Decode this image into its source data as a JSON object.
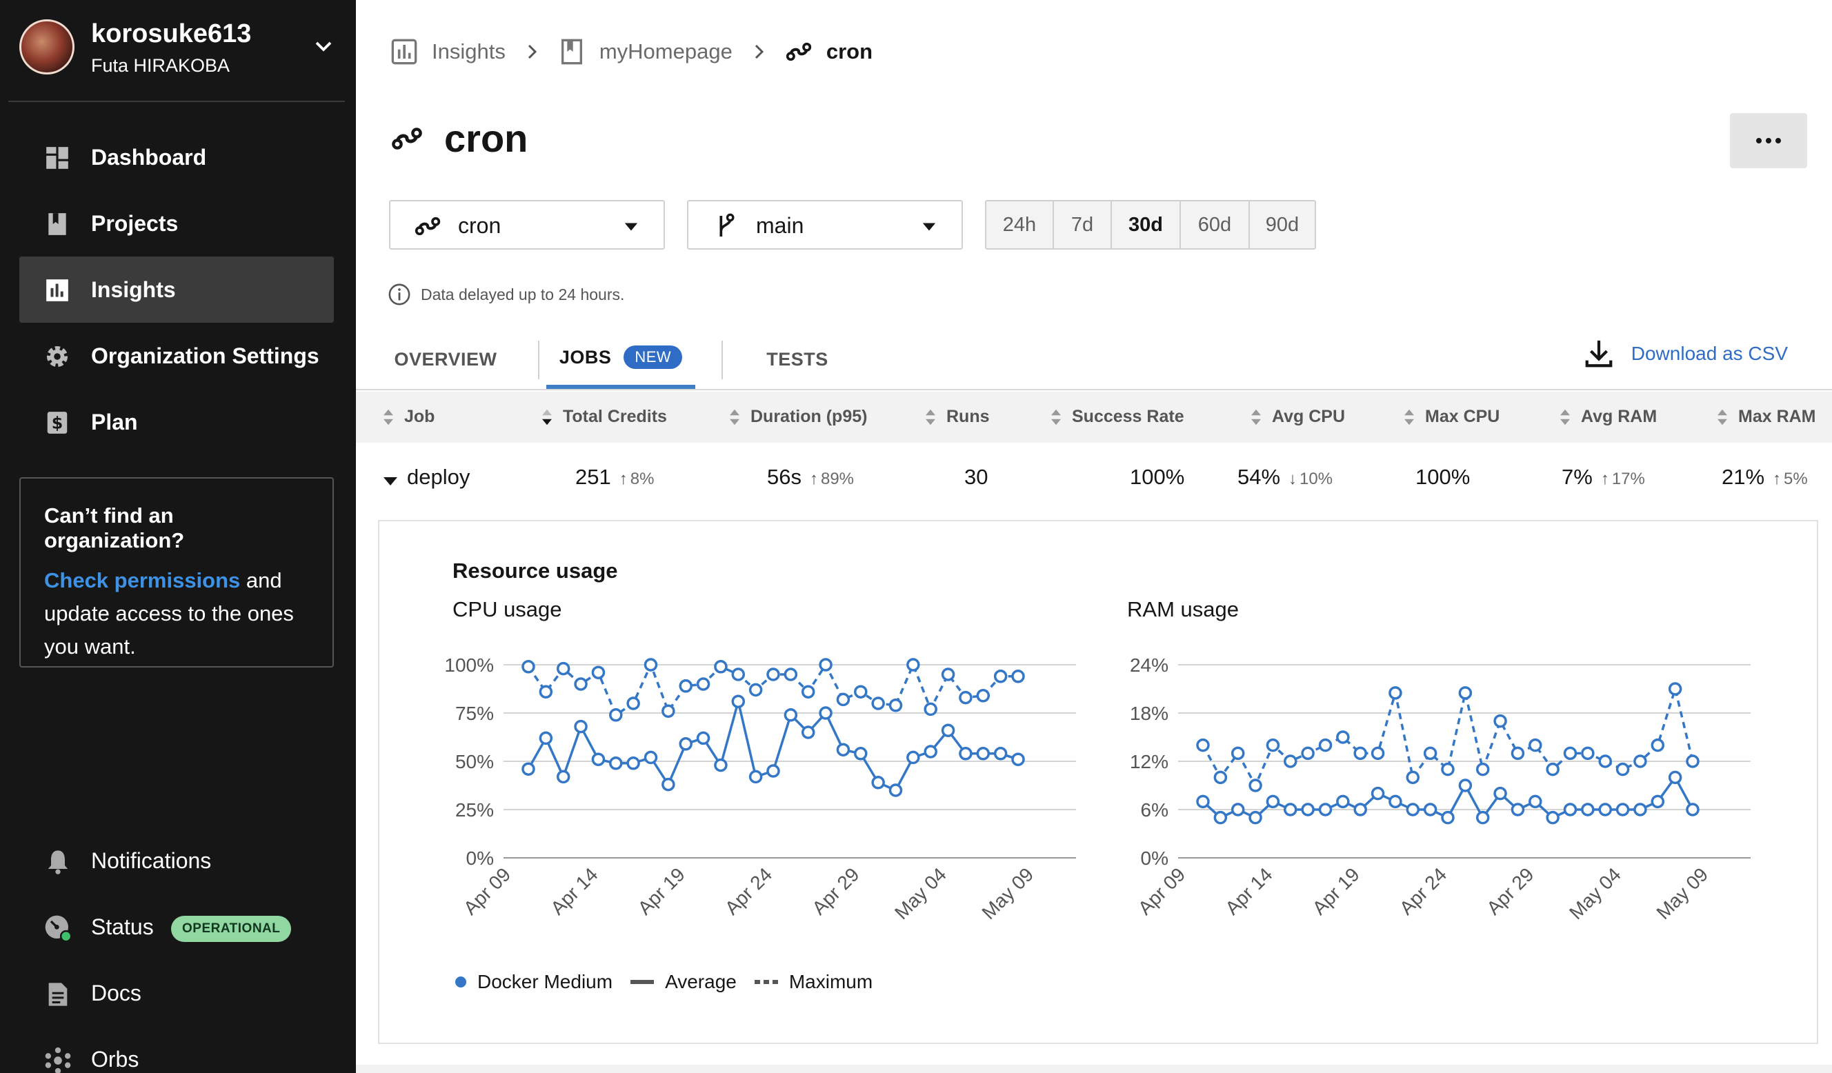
{
  "user": {
    "username": "korosuke613",
    "full_name": "Futa HIRAKOBA"
  },
  "sidebar": {
    "items": [
      {
        "label": "Dashboard",
        "icon": "dashboard-icon"
      },
      {
        "label": "Projects",
        "icon": "book-icon"
      },
      {
        "label": "Insights",
        "icon": "bar-chart-icon",
        "active": true
      },
      {
        "label": "Organization Settings",
        "icon": "gear-icon"
      },
      {
        "label": "Plan",
        "icon": "dollar-icon"
      }
    ],
    "org_box": {
      "title": "Can’t find an organization?",
      "link": "Check permissions",
      "text_after_link": " and update access to the ones you want."
    },
    "bottom_items": [
      {
        "label": "Notifications",
        "icon": "bell-icon"
      },
      {
        "label": "Status",
        "icon": "gauge-icon",
        "badge": "OPERATIONAL"
      },
      {
        "label": "Docs",
        "icon": "document-icon"
      },
      {
        "label": "Orbs",
        "icon": "orbs-icon"
      }
    ]
  },
  "breadcrumb": {
    "items": [
      "Insights",
      "myHomepage",
      "cron"
    ]
  },
  "page": {
    "title": "cron"
  },
  "filters": {
    "workflow": "cron",
    "branch": "main",
    "ranges": [
      "24h",
      "7d",
      "30d",
      "60d",
      "90d"
    ],
    "selected_range": "30d"
  },
  "notice": "Data delayed up to 24 hours.",
  "tabs": {
    "overview": "OVERVIEW",
    "jobs": "JOBS",
    "jobs_badge": "NEW",
    "tests": "TESTS",
    "active": "JOBS"
  },
  "download_label": "Download as CSV",
  "table": {
    "headers": {
      "job": "Job",
      "credits": "Total Credits",
      "duration": "Duration (p95)",
      "runs": "Runs",
      "success": "Success Rate",
      "avg_cpu": "Avg CPU",
      "max_cpu": "Max CPU",
      "avg_ram": "Avg RAM",
      "max_ram": "Max RAM"
    },
    "row": {
      "job": "deploy",
      "credits": "251",
      "credits_delta": "8%",
      "credits_dir": "up",
      "duration": "56s",
      "duration_delta": "89%",
      "duration_dir": "up",
      "runs": "30",
      "success": "100%",
      "avg_cpu": "54%",
      "avg_cpu_delta": "10%",
      "avg_cpu_dir": "down",
      "max_cpu": "100%",
      "avg_ram": "7%",
      "avg_ram_delta": "17%",
      "avg_ram_dir": "up",
      "max_ram": "21%",
      "max_ram_delta": "5%",
      "max_ram_dir": "up"
    }
  },
  "resource": {
    "title": "Resource usage",
    "legend": {
      "series": "Docker Medium",
      "average": "Average",
      "maximum": "Maximum"
    }
  },
  "colors": {
    "accent": "#3477c7",
    "badge_green": "#90d7a2",
    "sidebar_bg": "#161616"
  },
  "chart_data": [
    {
      "type": "line",
      "title": "CPU usage",
      "x_ticks": [
        "Apr 09",
        "Apr 14",
        "Apr 19",
        "Apr 24",
        "Apr 29",
        "May 04",
        "May 09"
      ],
      "y_ticks": [
        "0%",
        "25%",
        "50%",
        "75%",
        "100%"
      ],
      "ylim": [
        0,
        100
      ],
      "series": [
        {
          "name": "Average",
          "style": "solid",
          "values": [
            46,
            62,
            42,
            68,
            51,
            49,
            49,
            52,
            38,
            59,
            62,
            48,
            81,
            42,
            45,
            74,
            65,
            75,
            56,
            54,
            39,
            35,
            52,
            55,
            66,
            54,
            54,
            54,
            51
          ]
        },
        {
          "name": "Maximum",
          "style": "dashed",
          "values": [
            99,
            86,
            98,
            90,
            96,
            74,
            80,
            100,
            76,
            89,
            90,
            99,
            95,
            87,
            95,
            95,
            86,
            100,
            82,
            86,
            80,
            79,
            100,
            77,
            95,
            83,
            84,
            94,
            94
          ]
        }
      ]
    },
    {
      "type": "line",
      "title": "RAM usage",
      "x_ticks": [
        "Apr 09",
        "Apr 14",
        "Apr 19",
        "Apr 24",
        "Apr 29",
        "May 04",
        "May 09"
      ],
      "y_ticks": [
        "0%",
        "6%",
        "12%",
        "18%",
        "24%"
      ],
      "ylim": [
        0,
        24
      ],
      "series": [
        {
          "name": "Average",
          "style": "solid",
          "values": [
            7,
            5,
            6,
            5,
            7,
            6,
            6,
            6,
            7,
            6,
            8,
            7,
            6,
            6,
            5,
            9,
            5,
            8,
            6,
            7,
            5,
            6,
            6,
            6,
            6,
            6,
            7,
            10,
            6
          ]
        },
        {
          "name": "Maximum",
          "style": "dashed",
          "values": [
            14,
            10,
            13,
            9,
            14,
            12,
            13,
            14,
            15,
            13,
            13,
            20.5,
            10,
            13,
            11,
            20.5,
            11,
            17,
            13,
            14,
            11,
            13,
            13,
            12,
            11,
            12,
            14,
            21,
            12
          ]
        }
      ]
    }
  ]
}
